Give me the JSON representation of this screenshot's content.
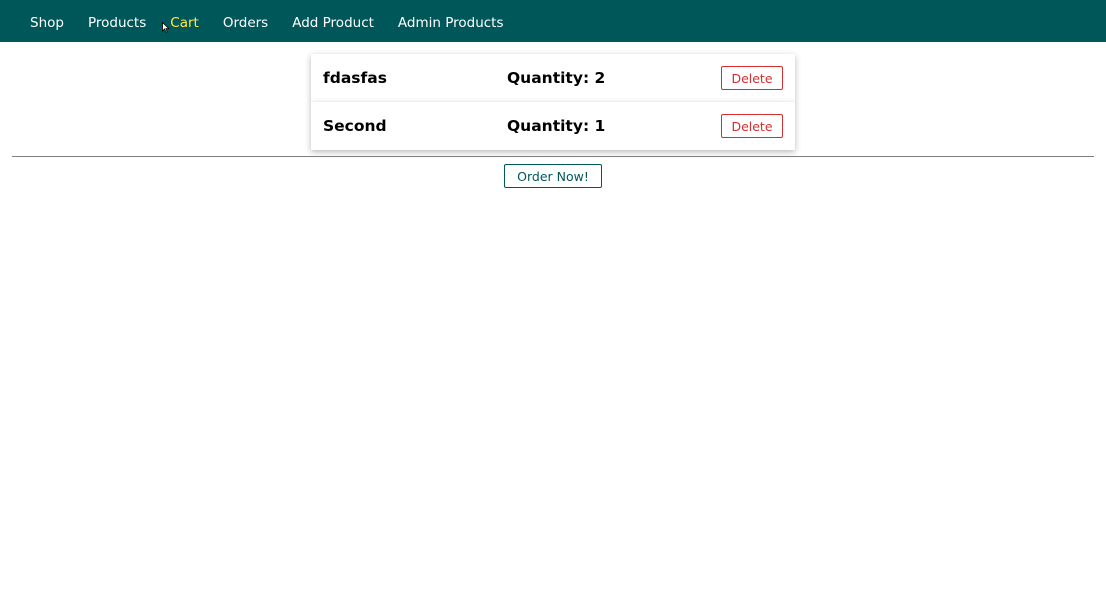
{
  "nav": {
    "items": [
      {
        "label": "Shop"
      },
      {
        "label": "Products"
      },
      {
        "label": "Cart",
        "active": true
      },
      {
        "label": "Orders"
      },
      {
        "label": "Add Product"
      },
      {
        "label": "Admin Products"
      }
    ],
    "active_color": "#ffeb3b",
    "background_color": "#00575a"
  },
  "cart": {
    "items": [
      {
        "title": "fdasfas",
        "quantity_text": "Quantity: 2",
        "delete_label": "Delete"
      },
      {
        "title": "Second",
        "quantity_text": "Quantity: 1",
        "delete_label": "Delete"
      }
    ]
  },
  "order": {
    "button_label": "Order Now!"
  },
  "colors": {
    "danger": "#d32f2f",
    "primary": "#00575a"
  }
}
